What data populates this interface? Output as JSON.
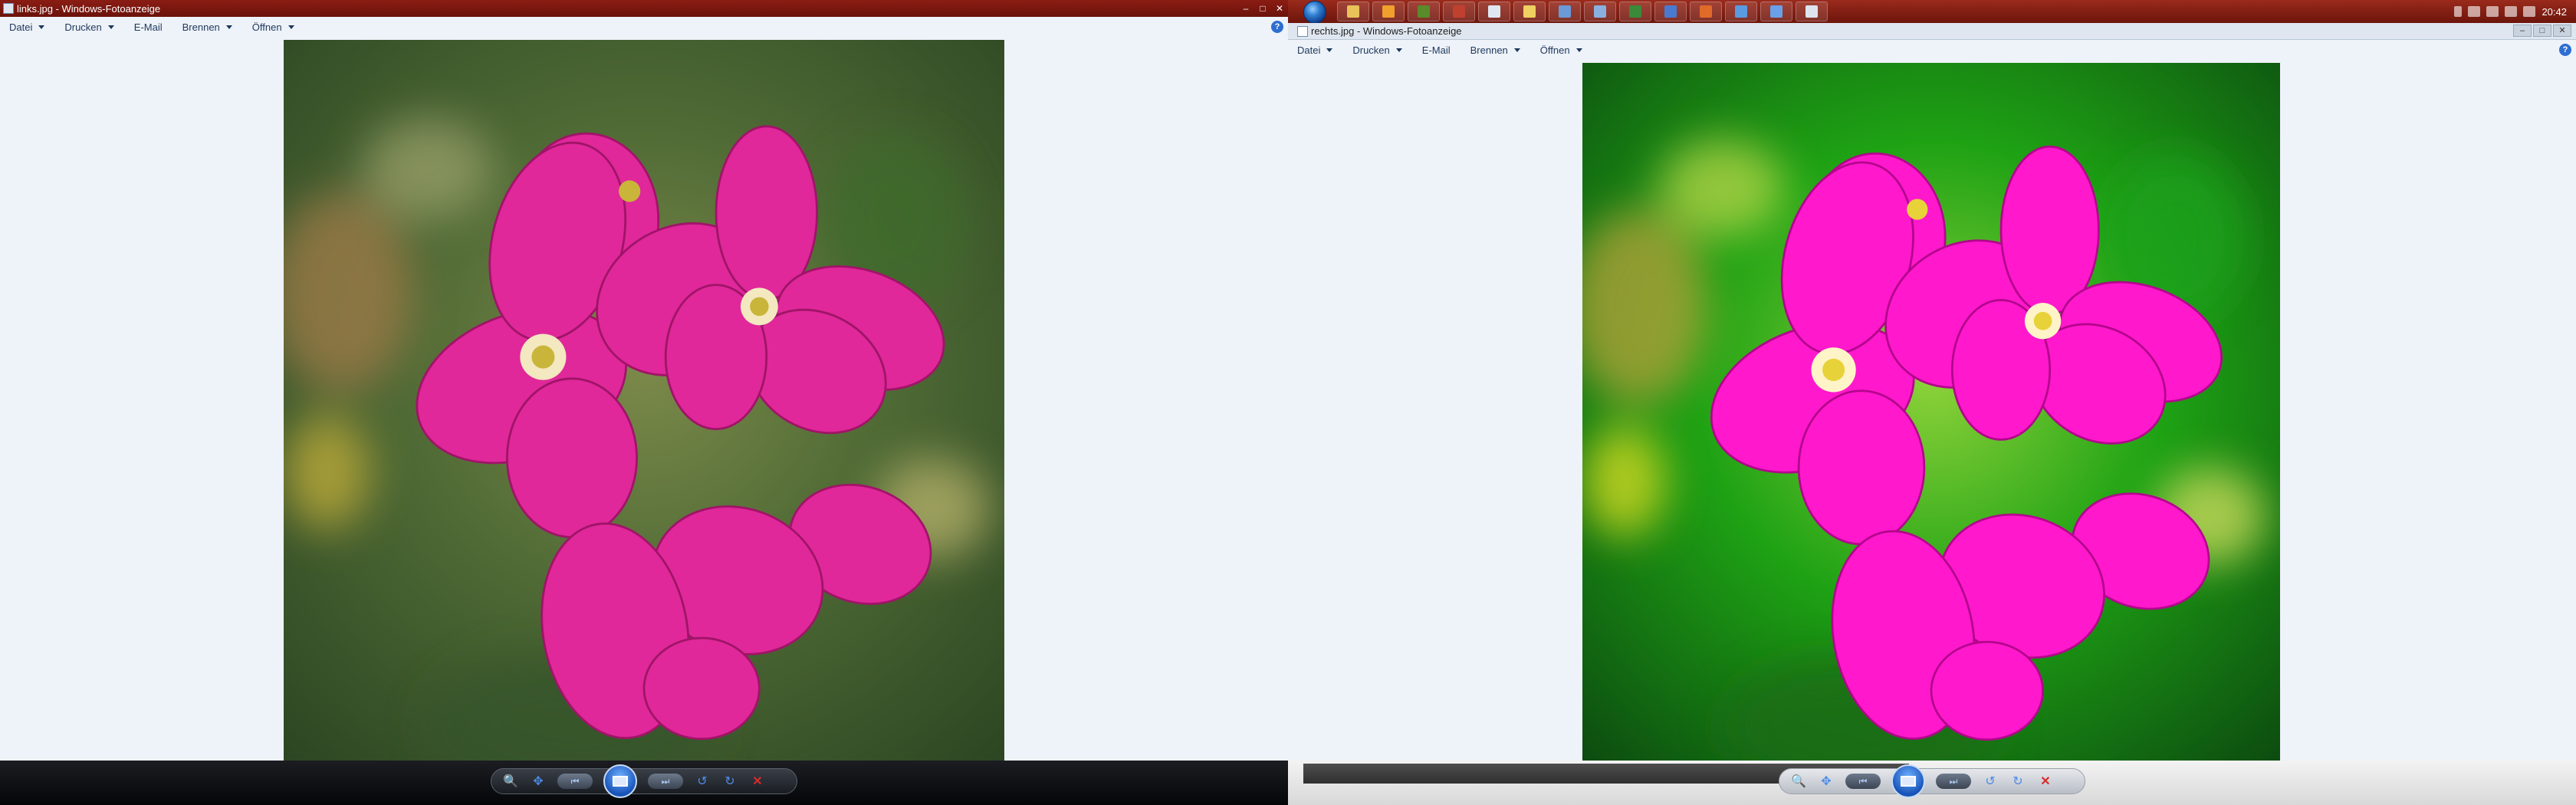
{
  "left": {
    "title": "links.jpg - Windows-Fotoanzeige",
    "menu": [
      "Datei",
      "Drucken",
      "E-Mail",
      "Brennen",
      "Öffnen"
    ],
    "help": "?",
    "window_controls": [
      "–",
      "□",
      "✕"
    ],
    "controls": [
      "zoom-icon",
      "fit-icon",
      "previous-icon",
      "slideshow-icon",
      "next-icon",
      "rotate-left-icon",
      "rotate-right-icon",
      "delete-icon"
    ]
  },
  "right": {
    "title": "rechts.jpg - Windows-Fotoanzeige",
    "menu": [
      "Datei",
      "Drucken",
      "E-Mail",
      "Brennen",
      "Öffnen"
    ],
    "help": "?",
    "window_controls": [
      "–",
      "□",
      "✕"
    ],
    "controls": [
      "zoom-icon",
      "fit-icon",
      "previous-icon",
      "slideshow-icon",
      "next-icon",
      "rotate-left-icon",
      "rotate-right-icon",
      "delete-icon"
    ]
  },
  "taskbar": {
    "clock": "20:42",
    "apps": [
      "explorer-icon",
      "media-icon",
      "app-icon",
      "app-icon",
      "app-icon",
      "app-icon",
      "app-icon",
      "app-icon",
      "app-icon",
      "app-icon",
      "app-icon",
      "app-icon",
      "app-icon",
      "app-icon"
    ]
  },
  "colors": {
    "title_red": "#7a1a10",
    "window_bg": "#eef2f9",
    "menu_text": "#1e395b",
    "flower_left": "#e0289a",
    "flower_right": "#ff18cc",
    "bg_left": "#4f6a35",
    "bg_right": "#1ea214"
  }
}
